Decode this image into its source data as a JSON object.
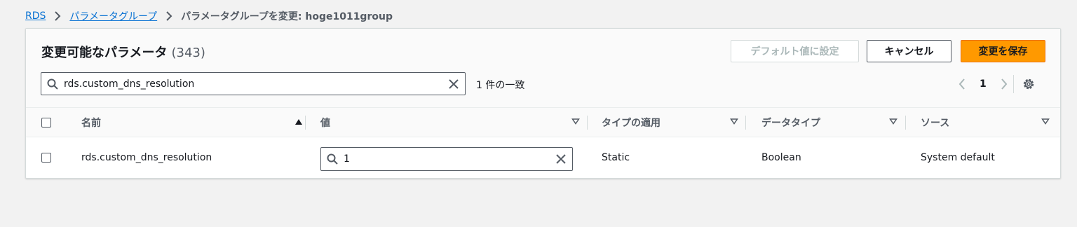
{
  "breadcrumb": {
    "items": [
      "RDS",
      "パラメータグループ"
    ],
    "current": "パラメータグループを変更: hoge1011group"
  },
  "panel": {
    "title": "変更可能なパラメータ",
    "count": "(343)",
    "buttons": {
      "reset_default": "デフォルト値に設定",
      "cancel": "キャンセル",
      "save": "変更を保存"
    },
    "search": {
      "value": "rds.custom_dns_resolution"
    },
    "match_text": "1 件の一致",
    "pagination": {
      "page": "1"
    }
  },
  "table": {
    "columns": [
      "名前",
      "値",
      "タイプの適用",
      "データタイプ",
      "ソース"
    ],
    "rows": [
      {
        "name": "rds.custom_dns_resolution",
        "value": "1",
        "apply_type": "Static",
        "data_type": "Boolean",
        "source": "System default"
      }
    ]
  },
  "colors": {
    "link": "#0972d3",
    "primary_button": "#ff9900",
    "text": "#16191f",
    "muted": "#545b64"
  }
}
